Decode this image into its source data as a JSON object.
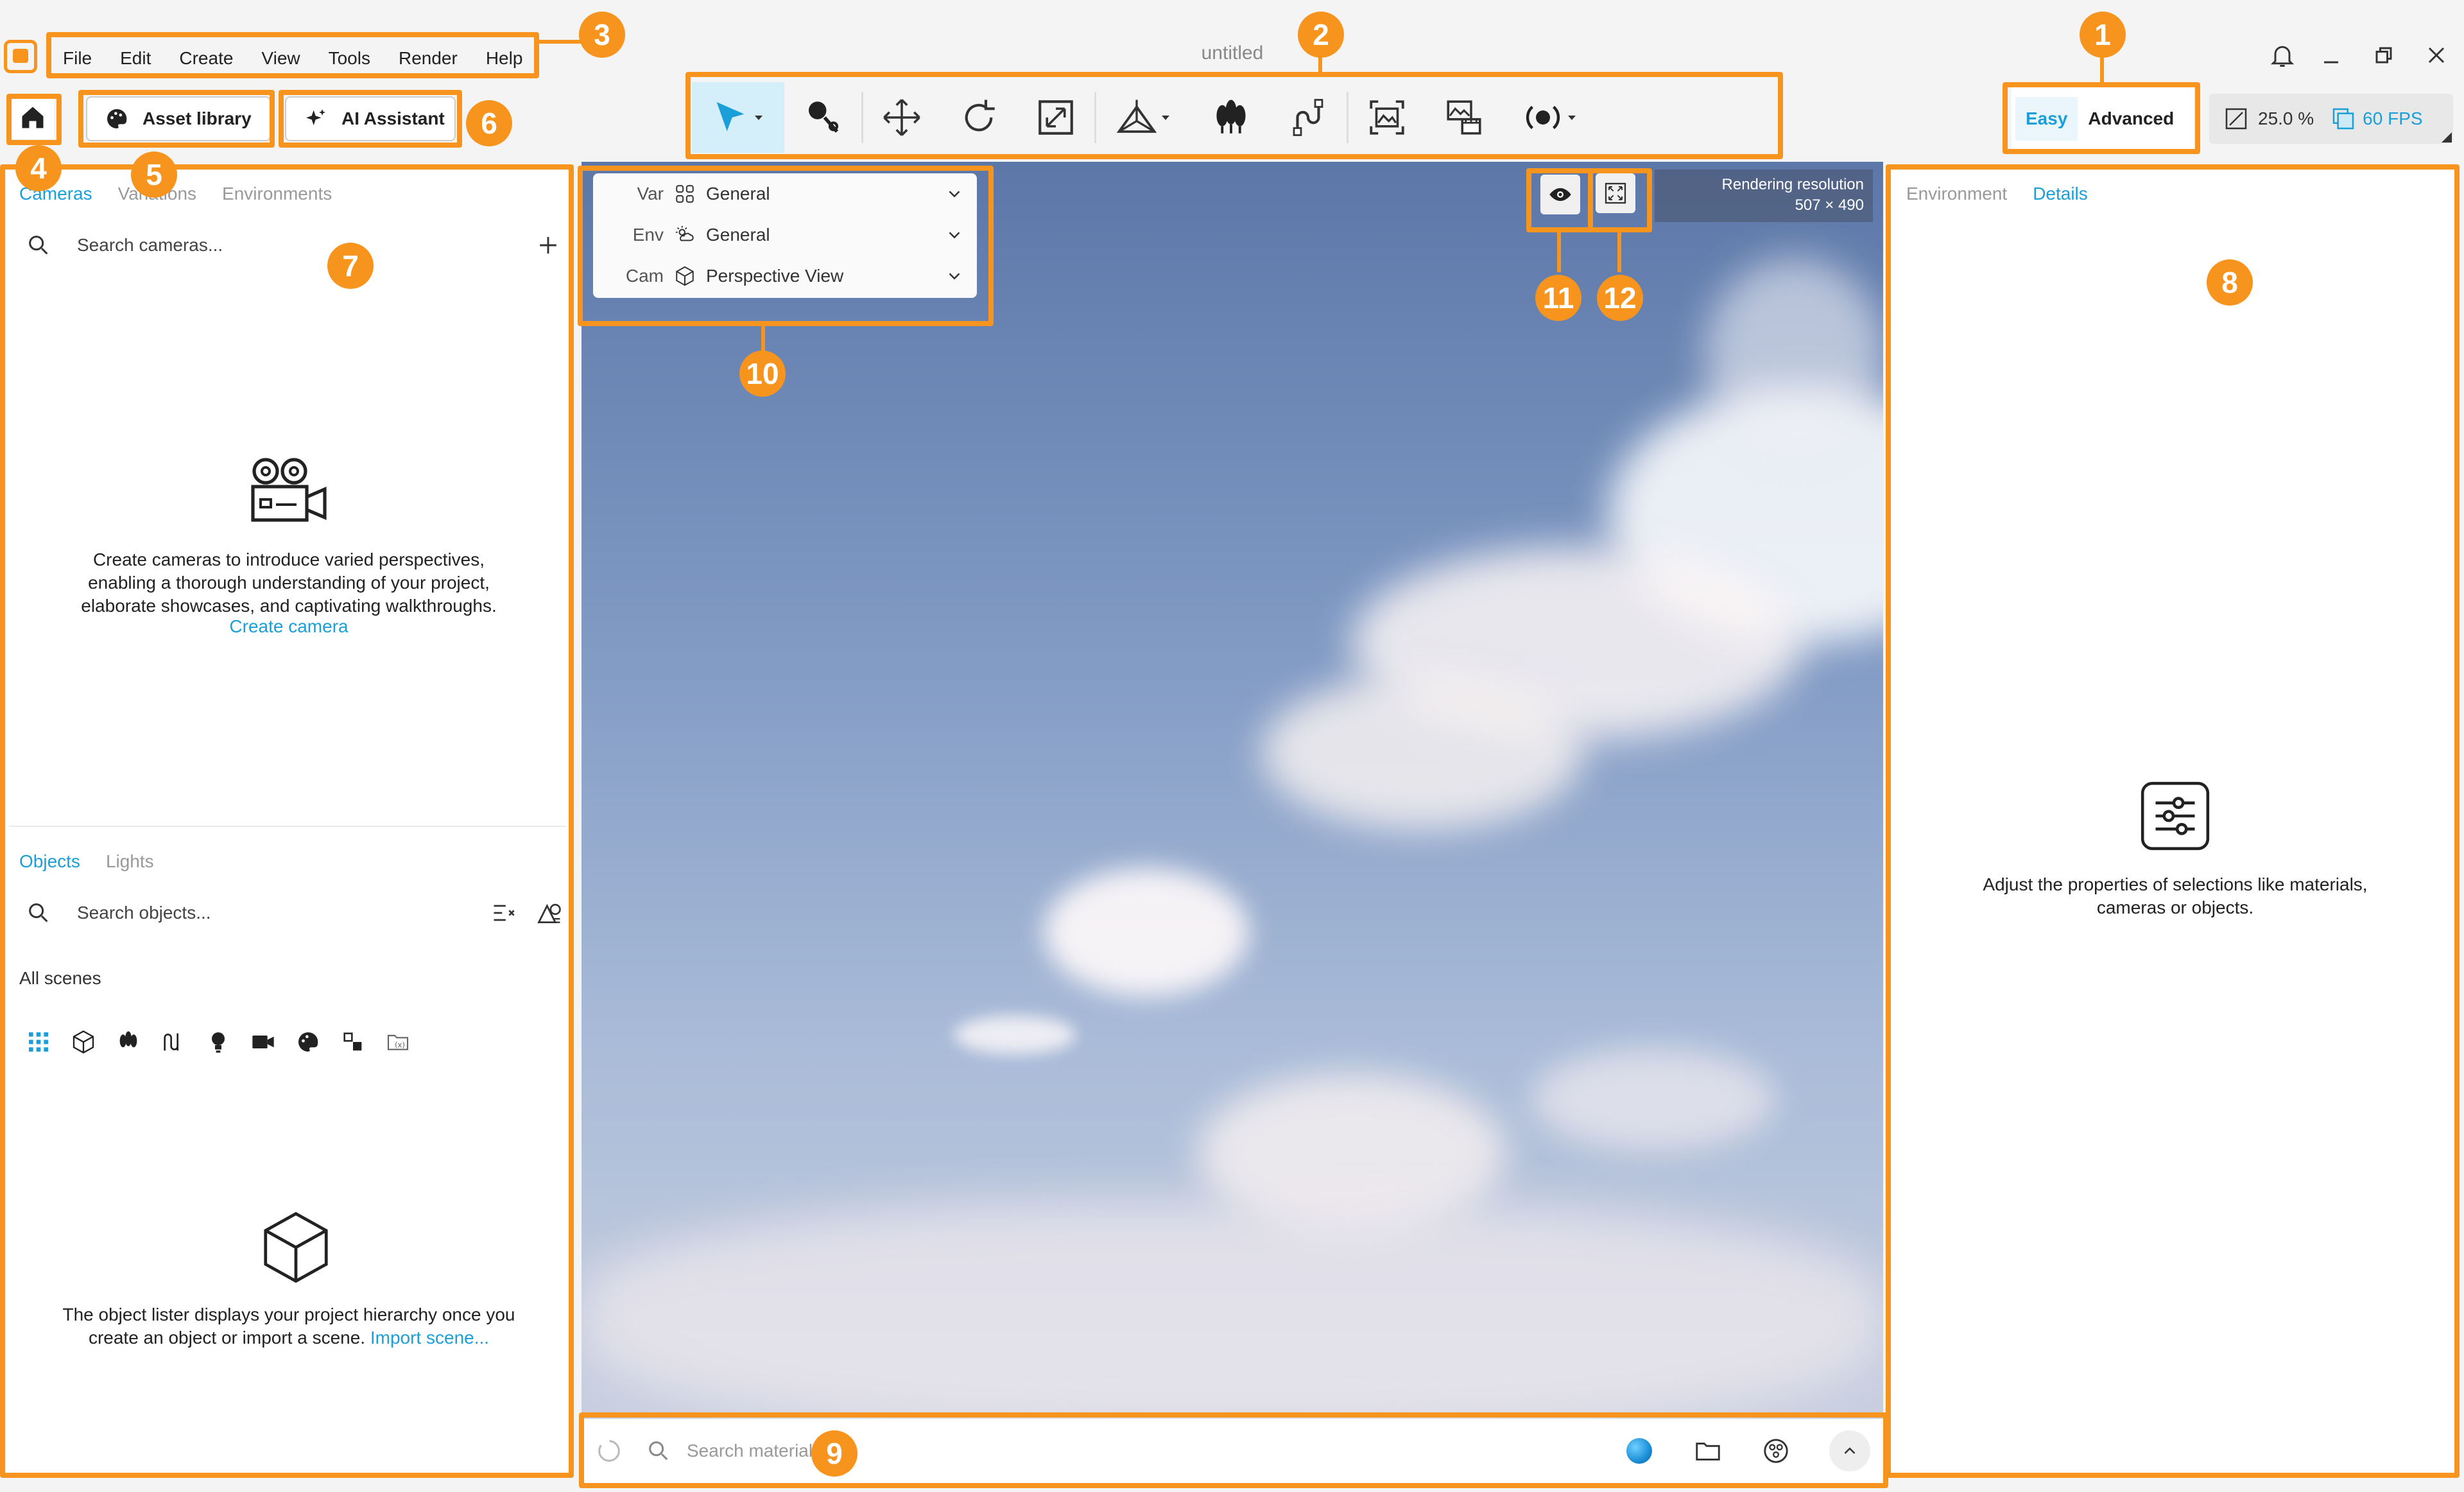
{
  "window": {
    "title": "untitled"
  },
  "menu": [
    "File",
    "Edit",
    "Create",
    "View",
    "Tools",
    "Render",
    "Help"
  ],
  "header": {
    "asset_library": "Asset library",
    "ai_assistant": "AI Assistant"
  },
  "mode": {
    "easy": "Easy",
    "advanced": "Advanced"
  },
  "stats": {
    "zoom": "25.0 %",
    "fps": "60 FPS"
  },
  "left_panel": {
    "tabs": [
      "Cameras",
      "Variations",
      "Environments"
    ],
    "search_cameras_placeholder": "Search cameras...",
    "cameras_empty_text": "Create cameras to introduce varied perspectives, enabling a thorough understanding of your project, elaborate showcases, and captivating walkthroughs.",
    "create_camera_link": "Create camera",
    "bottom_tabs": [
      "Objects",
      "Lights"
    ],
    "search_objects_placeholder": "Search objects...",
    "all_scenes": "All scenes",
    "objects_empty_text": "The object lister displays your project hierarchy once you create an object or import a scene.",
    "import_scene_link": "Import scene..."
  },
  "viewport": {
    "rows": [
      {
        "label": "Var",
        "value": "General"
      },
      {
        "label": "Env",
        "value": "General"
      },
      {
        "label": "Cam",
        "value": "Perspective View"
      }
    ],
    "render_res_label": "Rendering resolution",
    "render_res_value": "507 × 490",
    "material_search_placeholder": "Search materials"
  },
  "right_panel": {
    "tabs": [
      "Environment",
      "Details"
    ],
    "empty_text": "Adjust the properties of selections like materials, cameras or objects."
  },
  "callouts": [
    "1",
    "2",
    "3",
    "4",
    "5",
    "6",
    "7",
    "8",
    "9",
    "10",
    "11",
    "12"
  ],
  "colors": {
    "accent": "#1a9fd8",
    "callout": "#f7941d"
  }
}
